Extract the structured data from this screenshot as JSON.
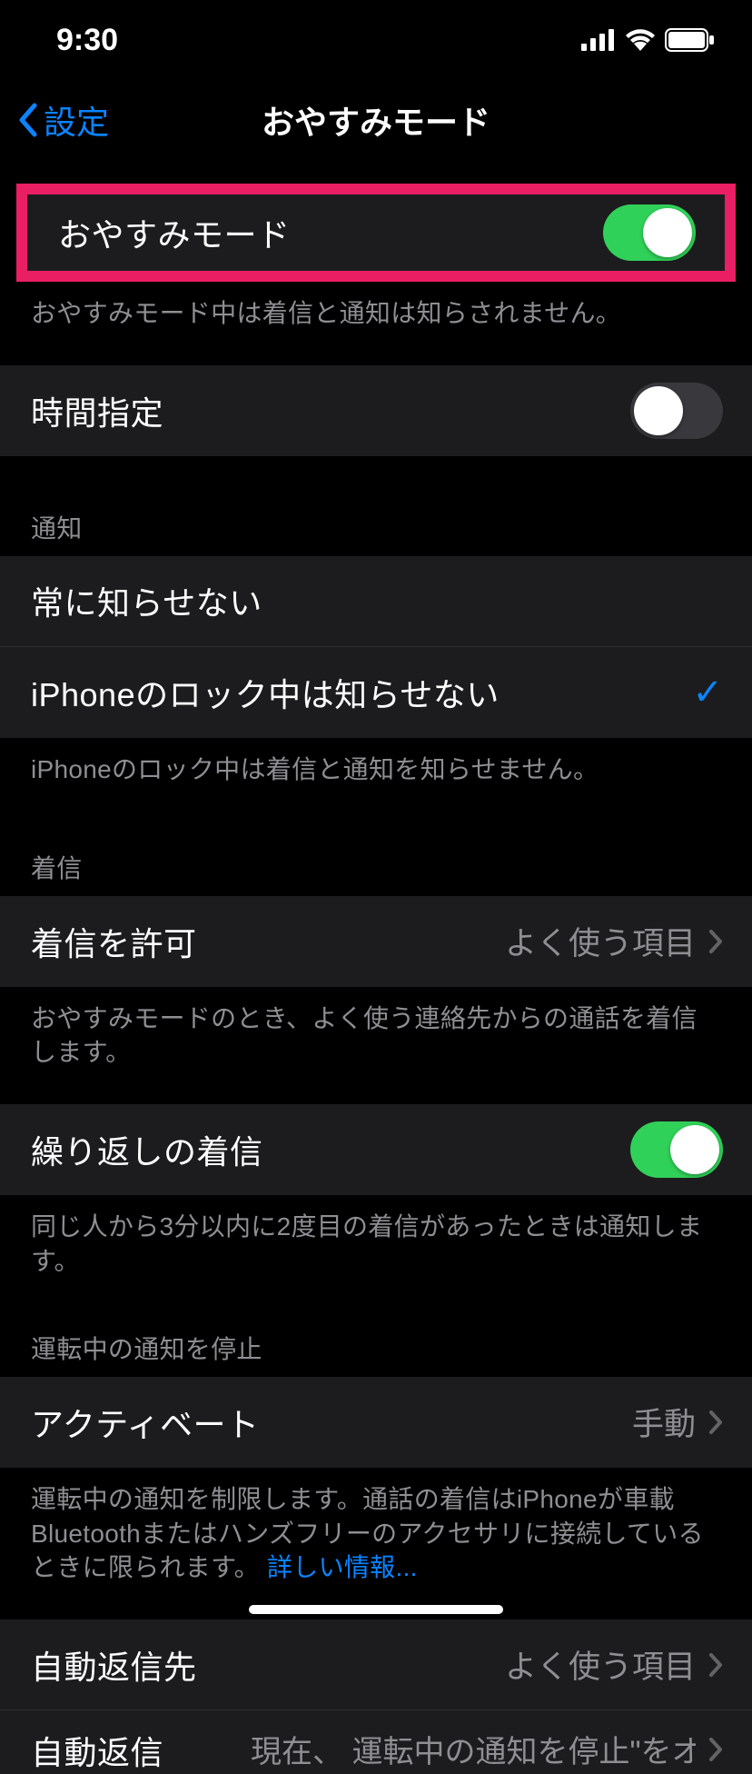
{
  "statusBar": {
    "time": "9:30"
  },
  "nav": {
    "back": "設定",
    "title": "おやすみモード"
  },
  "section1": {
    "dndLabel": "おやすみモード",
    "dndFooter": "おやすみモード中は着信と通知は知らされません。",
    "scheduleLabel": "時間指定"
  },
  "section2": {
    "header": "通知",
    "alwaysSilence": "常に知らせない",
    "whileLocked": "iPhoneのロック中は知らせない",
    "footer": "iPhoneのロック中は着信と通知を知らせません。"
  },
  "section3": {
    "header": "着信",
    "allowCallsLabel": "着信を許可",
    "allowCallsValue": "よく使う項目",
    "allowCallsFooter": "おやすみモードのとき、よく使う連絡先からの通話を着信します。",
    "repeatedCallsLabel": "繰り返しの着信",
    "repeatedCallsFooter": "同じ人から3分以内に2度目の着信があったときは通知します。"
  },
  "section4": {
    "header": "運転中の通知を停止",
    "activateLabel": "アクティベート",
    "activateValue": "手動",
    "footerPart1": "運転中の通知を制限します。通話の着信はiPhoneが車載Bluetoothまたはハンズフリーのアクセサリに接続しているときに限られます。  ",
    "footerLink": "詳しい情報..."
  },
  "section5": {
    "autoReplyToLabel": "自動返信先",
    "autoReplyToValue": "よく使う項目",
    "autoReplyLabel": "自動返信",
    "autoReplyValue": "現在、  運転中の通知を停止\"をオン…"
  }
}
